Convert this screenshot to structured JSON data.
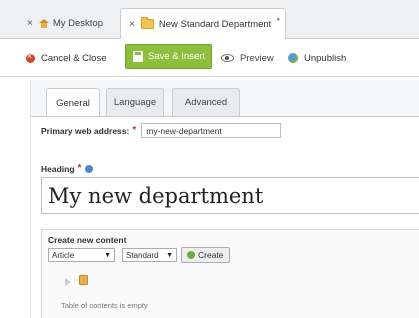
{
  "tabs": [
    {
      "label": "My Desktop",
      "close": "×"
    },
    {
      "label": "New Standard Department",
      "close": "×",
      "modified_marker": "*"
    }
  ],
  "toolbar": {
    "cancel_label": "Cancel & Close",
    "save_label": "Save & Insert",
    "preview_label": "Preview",
    "unpublish_label": "Unpublish",
    "save_button_color": "#8dbf3c"
  },
  "subtabs": [
    "General",
    "Language",
    "Advanced"
  ],
  "form": {
    "address_label": "Primary web address:",
    "required_marker": "*",
    "address_value": "my-new-department",
    "heading_label": "Heading",
    "heading_value": "My new department"
  },
  "content": {
    "title": "Create new content",
    "type_value": "Article",
    "template_value": "Standard",
    "create_label": "Create",
    "toc_empty": "Table of contents is empty"
  },
  "icons": [
    "home-icon",
    "folder-icon",
    "cancel-icon",
    "save-icon",
    "eye-icon",
    "globe-icon",
    "help-icon",
    "create-icon",
    "arrow-icon",
    "paste-icon"
  ]
}
